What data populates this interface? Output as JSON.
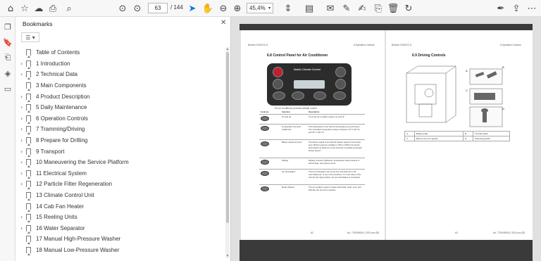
{
  "toolbar": {
    "page_current": "63",
    "page_total": "/ 144",
    "zoom": "45,4%"
  },
  "sidebar_panel": {
    "title": "Bookmarks",
    "close": "✕",
    "options": "☰ ▾",
    "bookmarks": [
      {
        "label": "Table of Contents",
        "expandable": false
      },
      {
        "label": "1 Introduction",
        "expandable": true
      },
      {
        "label": "2 Technical Data",
        "expandable": true
      },
      {
        "label": "3 Main Components",
        "expandable": false
      },
      {
        "label": "4 Product Description",
        "expandable": true
      },
      {
        "label": "5 Daily Maintenance",
        "expandable": true
      },
      {
        "label": "6 Operation Controls",
        "expandable": true
      },
      {
        "label": "7 Tramming/Driving",
        "expandable": true
      },
      {
        "label": "8 Prepare for Drilling",
        "expandable": true
      },
      {
        "label": "9 Transport",
        "expandable": true
      },
      {
        "label": "10 Maneuvering the Service Platform",
        "expandable": true
      },
      {
        "label": "11 Electrical System",
        "expandable": true
      },
      {
        "label": "12 Particle Filter Regeneration",
        "expandable": true
      },
      {
        "label": "13 Climate Control Unit",
        "expandable": false
      },
      {
        "label": "14 Cab Fan Heater",
        "expandable": false
      },
      {
        "label": "15 Reeling Units",
        "expandable": true
      },
      {
        "label": "16 Water Separator",
        "expandable": true
      },
      {
        "label": "17 Manual High-Pressure Washer",
        "expandable": false
      },
      {
        "label": "18 Manual Low-Pressure Washer",
        "expandable": false
      }
    ]
  },
  "document": {
    "left_page": {
      "header_left": "Boomer S1D/E1C-5",
      "header_right": "6 Operation Controls",
      "section_title": "6.8 Control Panel for Air Conditioner",
      "panel_label": "Mobile Climate Control",
      "caption": "The air conditioner provides climate control.",
      "table_headers": [
        "Controls",
        "Function",
        "Description"
      ],
      "table_rows": [
        {
          "function": "On and off",
          "description": "Turns the air condition system on and off."
        },
        {
          "function": "Temperature set point (Up/Down)",
          "description": "The temperature is set with the temperature set point keys. The controlled temperature range is between 16 °C (60 °F) and 32 °C (90 °F)."
        },
        {
          "function": "Blower speed set point",
          "description": "The blower speed is set with the blower speed up and down keys. Blower speed is variable in 10% to 100% increments. Hold speed up button for a few seconds to activate automatic blower speed."
        },
        {
          "function": "Display",
          "description": "Display contrast, brightness, temperature scale (Celsius or Fahrenheit), and system errors."
        },
        {
          "function": "Air recirculation",
          "description": "The air recirculation can be set from full fresh air to full recirculated air, or one of the positions. Turn the valve of the cab into the right position, the air recirculation is completed."
        },
        {
          "function": "Mode (Option)",
          "description": "The air condition system modes (Automatic, Heat, Cool, and Defrost) can be set by operator."
        }
      ],
      "footer_left": "62",
      "footer_right": "No. 7700000000 / 2021-mm-DD"
    },
    "right_page": {
      "header_left": "Boomer S1D/E1C-5",
      "header_right": "6 Operation Controls",
      "section_title": "6.9 Driving Controls",
      "callouts": [
        "A",
        "B",
        "C",
        "D"
      ],
      "table_rows": [
        [
          "A",
          "Brake pedal",
          "B",
          "Throttle pedal"
        ],
        [
          "C",
          "Buttons for turn signals",
          "D",
          "Steering joystick"
        ]
      ],
      "footer_left": "63",
      "footer_right": "No. 7700000000 / 2021-mm-DD"
    }
  }
}
